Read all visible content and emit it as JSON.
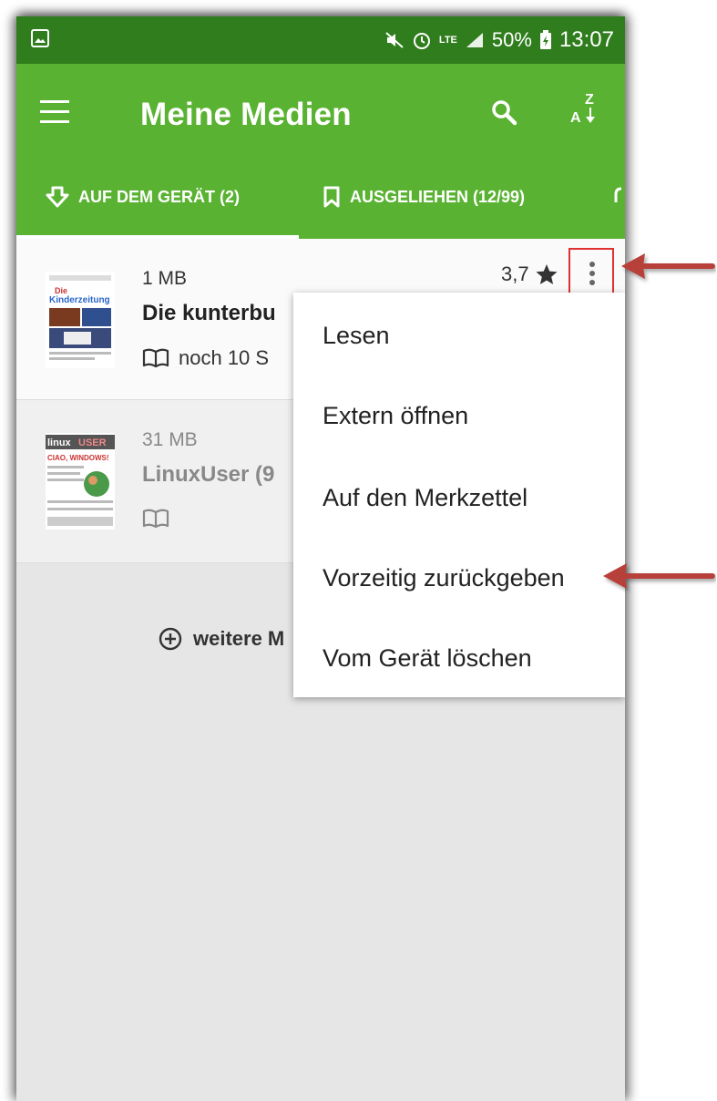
{
  "status_bar": {
    "battery_percent": "50%",
    "time": "13:07",
    "network": "LTE",
    "icons": [
      "image-icon",
      "mute-icon",
      "alarm-icon",
      "lte-icon",
      "signal-icon",
      "battery-icon"
    ]
  },
  "app_bar": {
    "title": "Meine Medien",
    "icons": [
      "menu-icon",
      "search-icon",
      "sort-az-icon"
    ],
    "sort_top": "Z",
    "sort_bottom": "A"
  },
  "tabs": [
    {
      "label": "AUF DEM GERÄT (2)",
      "icon": "download-icon",
      "selected": true
    },
    {
      "label": "AUSGELIEHEN (12/99)",
      "icon": "bookmark-icon",
      "selected": false
    },
    {
      "label": "",
      "icon": "bell-icon",
      "selected": false
    }
  ],
  "items": [
    {
      "size": "1 MB",
      "title": "Die kunterbu",
      "status": "noch 10 S",
      "rating": "3,7",
      "cover_text": "Die Kinderzeitung"
    },
    {
      "size": "31 MB",
      "title": "LinuxUser (9",
      "status": "",
      "cover_text": "linuxUSER",
      "cover_headline": "CIAO, WINDOWS!"
    }
  ],
  "more_link": "weitere M",
  "context_menu": [
    "Lesen",
    "Extern öffnen",
    "Auf den Merkzettel",
    "Vorzeitig zurückgeben",
    "Vom Gerät löschen"
  ],
  "colors": {
    "app_bar": "#59b232",
    "status_bar": "#2f7d1c",
    "annotation": "#c0392b"
  }
}
